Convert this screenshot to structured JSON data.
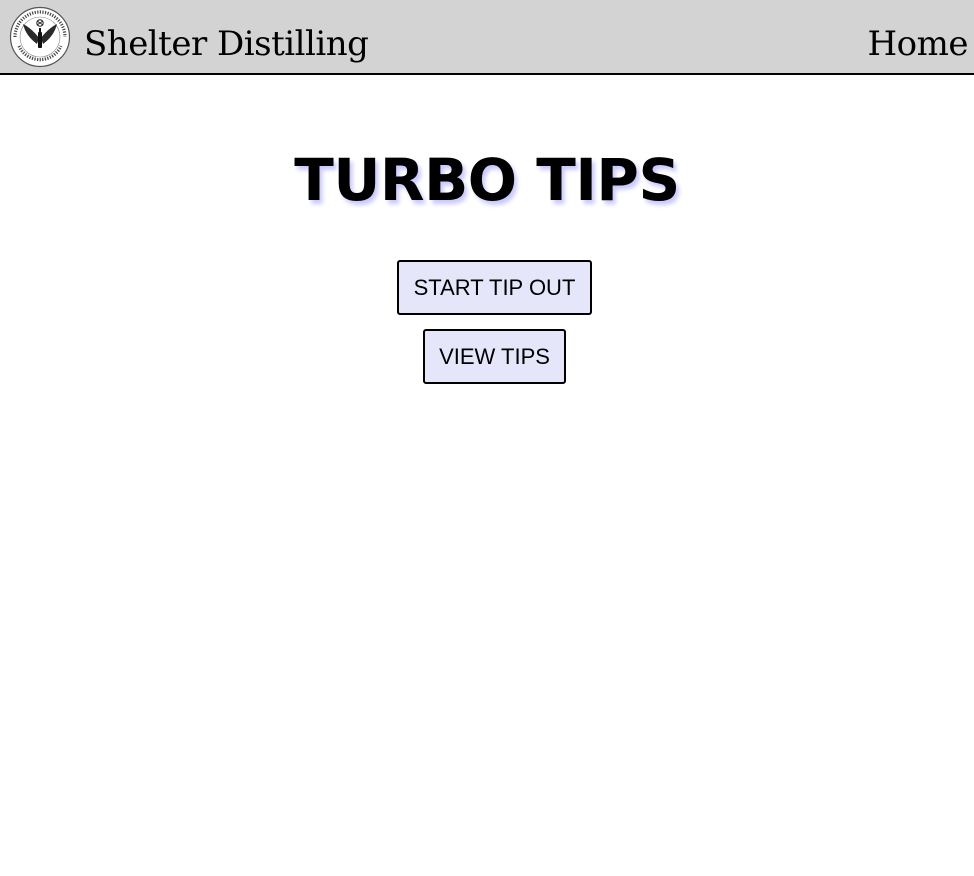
{
  "header": {
    "brand": "Shelter Distilling",
    "home_label": "Home",
    "logo_text": {
      "top_arc": "MADE IN MAMMOTH LAKES, CALIFORNIA",
      "bottom_arc": "SHELTER DISTILLING"
    }
  },
  "main": {
    "title": "TURBO TIPS",
    "buttons": {
      "start_tip_out": "START TIP OUT",
      "view_tips": "VIEW TIPS"
    }
  },
  "colors": {
    "header_bg": "#d3d3d3",
    "button_bg": "#e6e6fa",
    "title_shadow": "#c8c8ff"
  }
}
